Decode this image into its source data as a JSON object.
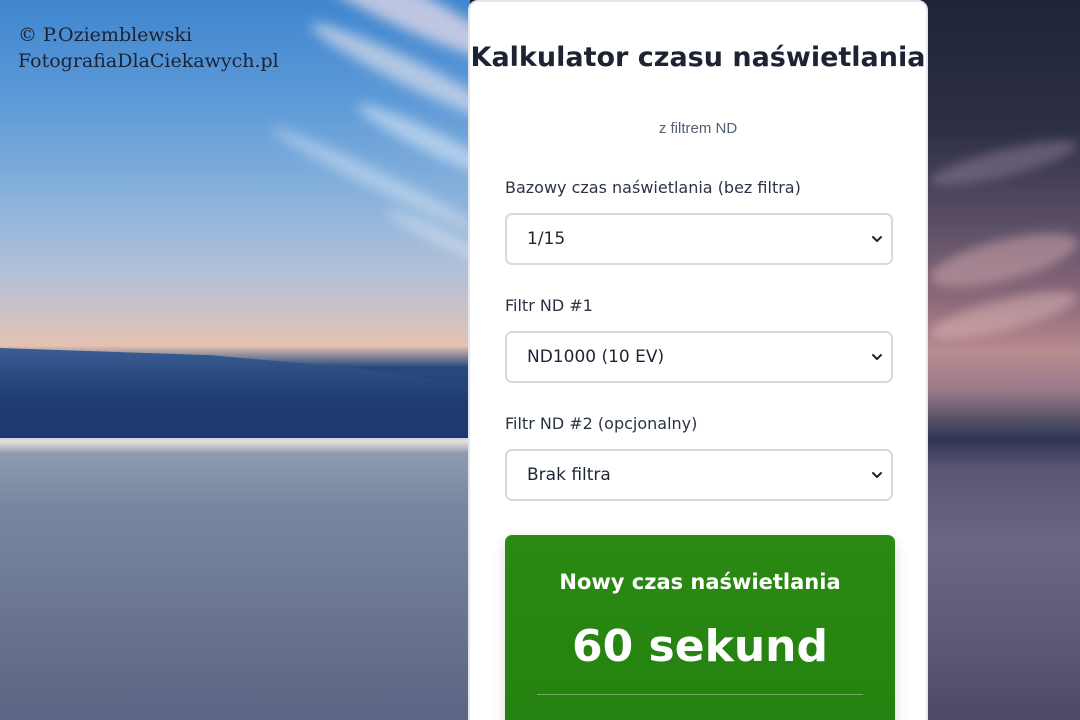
{
  "watermark": {
    "line1": "© P.Oziemblewski",
    "line2": "FotografiaDlaCiekawych.pl"
  },
  "calculator": {
    "title": "Kalkulator czasu naświetlania",
    "subtitle": "z filtrem ND",
    "fields": [
      {
        "label": "Bazowy czas naświetlania (bez filtra)",
        "value": "1/15"
      },
      {
        "label": "Filtr ND #1",
        "value": "ND1000 (10 EV)"
      },
      {
        "label": "Filtr ND #2 (opcjonalny)",
        "value": "Brak filtra"
      }
    ],
    "result": {
      "title": "Nowy czas naświetlania",
      "value": "60 sekund"
    }
  },
  "icons": {
    "dropdown": "chevron-down-icon"
  },
  "colors": {
    "result_green": "#23800f",
    "card_bg": "#ffffff",
    "text_dark": "#1c2434"
  }
}
